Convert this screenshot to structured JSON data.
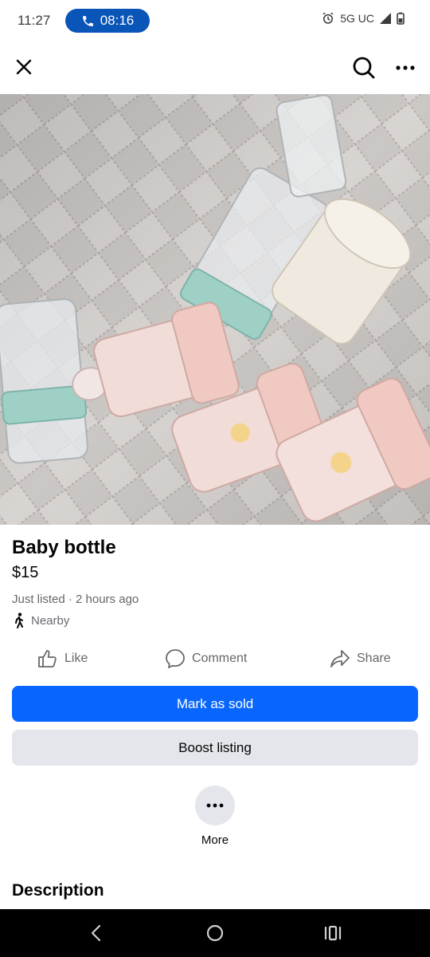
{
  "status_bar": {
    "time": "11:27",
    "call_duration": "08:16",
    "network": "5G UC",
    "icons": [
      "phone-icon",
      "alarm-icon",
      "signal-icon",
      "battery-icon"
    ]
  },
  "header": {
    "icons": [
      "close-icon",
      "search-icon",
      "more-horizontal-icon"
    ]
  },
  "listing": {
    "title": "Baby bottle",
    "price": "$15",
    "listed_text": "Just listed · 2 hours ago",
    "location": "Nearby",
    "photo_subject": "baby bottles on quilted mattress"
  },
  "actions": {
    "like": "Like",
    "comment": "Comment",
    "share": "Share"
  },
  "buttons": {
    "mark_sold": "Mark as sold",
    "boost": "Boost listing",
    "more": "More"
  },
  "sections": {
    "description_heading": "Description"
  },
  "colors": {
    "primary": "#0866ff",
    "secondary_bg": "#e4e6eb",
    "call_pill": "#0a55b8",
    "muted_text": "#65676b"
  }
}
